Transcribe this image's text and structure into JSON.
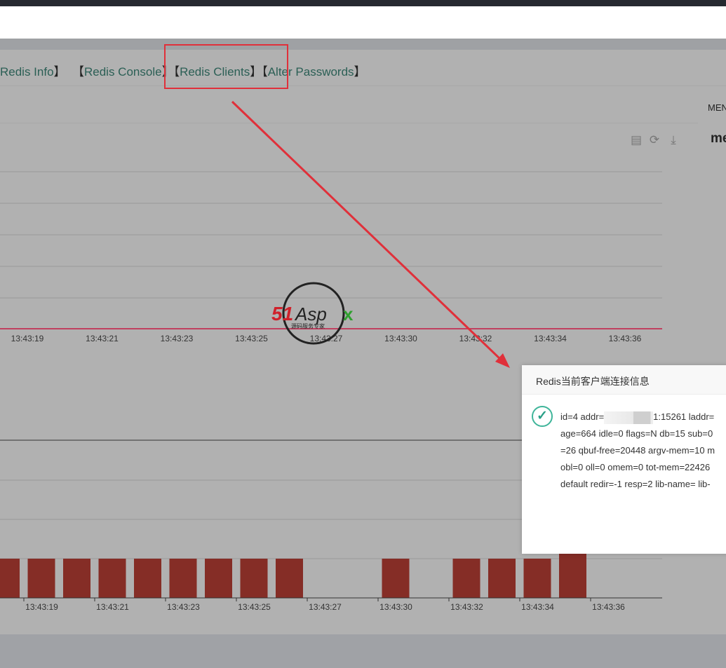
{
  "nav": {
    "items": [
      "Redis Info",
      "Redis Console",
      "Redis Clients",
      "Alter Passwords"
    ],
    "bracket_open": "【",
    "bracket_close": "】"
  },
  "side": {
    "label": "MEN",
    "bold": "me"
  },
  "toolbar": {
    "icons": [
      "data-view-icon",
      "refresh-icon",
      "download-icon"
    ]
  },
  "watermark": {
    "text": "51Aspx",
    "sub": "源码服务专家"
  },
  "colors": {
    "bar": "#852d26",
    "line": "#c04060",
    "link": "#2b5f55",
    "accent": "#3fb59a",
    "annotation": "#e0303a"
  },
  "chart_data": [
    {
      "type": "line",
      "categories": [
        "13:43:19",
        "13:43:21",
        "13:43:23",
        "13:43:25",
        "13:43:27",
        "13:43:30",
        "13:43:32",
        "13:43:34",
        "13:43:36"
      ],
      "values": [
        0,
        0,
        0,
        0,
        0,
        0,
        0,
        0,
        0
      ],
      "grid": true
    },
    {
      "type": "bar",
      "categories": [
        "",
        "13:43:19",
        "",
        "13:43:21",
        "",
        "13:43:23",
        "",
        "13:43:25",
        "",
        "13:43:27",
        "",
        "13:43:30",
        "",
        "13:43:32",
        "",
        "13:43:34",
        "",
        "13:43:36"
      ],
      "values": [
        1,
        1,
        1,
        1,
        1,
        1,
        1,
        1,
        1,
        0,
        0,
        1,
        0,
        1,
        1,
        1,
        2,
        0
      ],
      "grid": true
    }
  ],
  "dialog": {
    "title": "Redis当前客户端连接信息",
    "lines": [
      "id=4 addr=",
      "1:15261 laddr=",
      "age=664 idle=0 flags=N db=15 sub=0",
      "=26 qbuf-free=20448 argv-mem=10 m",
      "obl=0 oll=0 omem=0 tot-mem=22426 ",
      "default redir=-1 resp=2 lib-name= lib-"
    ]
  }
}
